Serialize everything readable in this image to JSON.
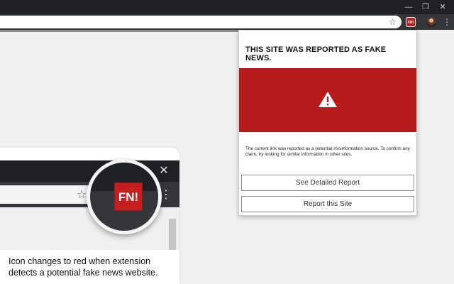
{
  "browser": {
    "window_controls": {
      "minimize": "—",
      "maximize": "❐",
      "close": "✕"
    },
    "star_glyph": "☆",
    "extension_badge": "FN!",
    "menu_glyph": "⋮"
  },
  "popup": {
    "title": "THIS SITE WAS REPORTED AS FAKE NEWS.",
    "alert_color": "#b71c1c",
    "warning_icon": "warning-triangle-icon",
    "message": "The current link was reported as a potential misinformation source. To confirm any claim, try looking for similar information in other sites.",
    "buttons": {
      "detailed_report": "See Detailed Report",
      "report_site": "Report this Site"
    }
  },
  "callout": {
    "close_glyph": "✕",
    "star_glyph": "☆",
    "menu_glyph": "⋮",
    "badge_text": "FN!",
    "caption": "Icon changes to red when extension detects a potential fake news website."
  }
}
